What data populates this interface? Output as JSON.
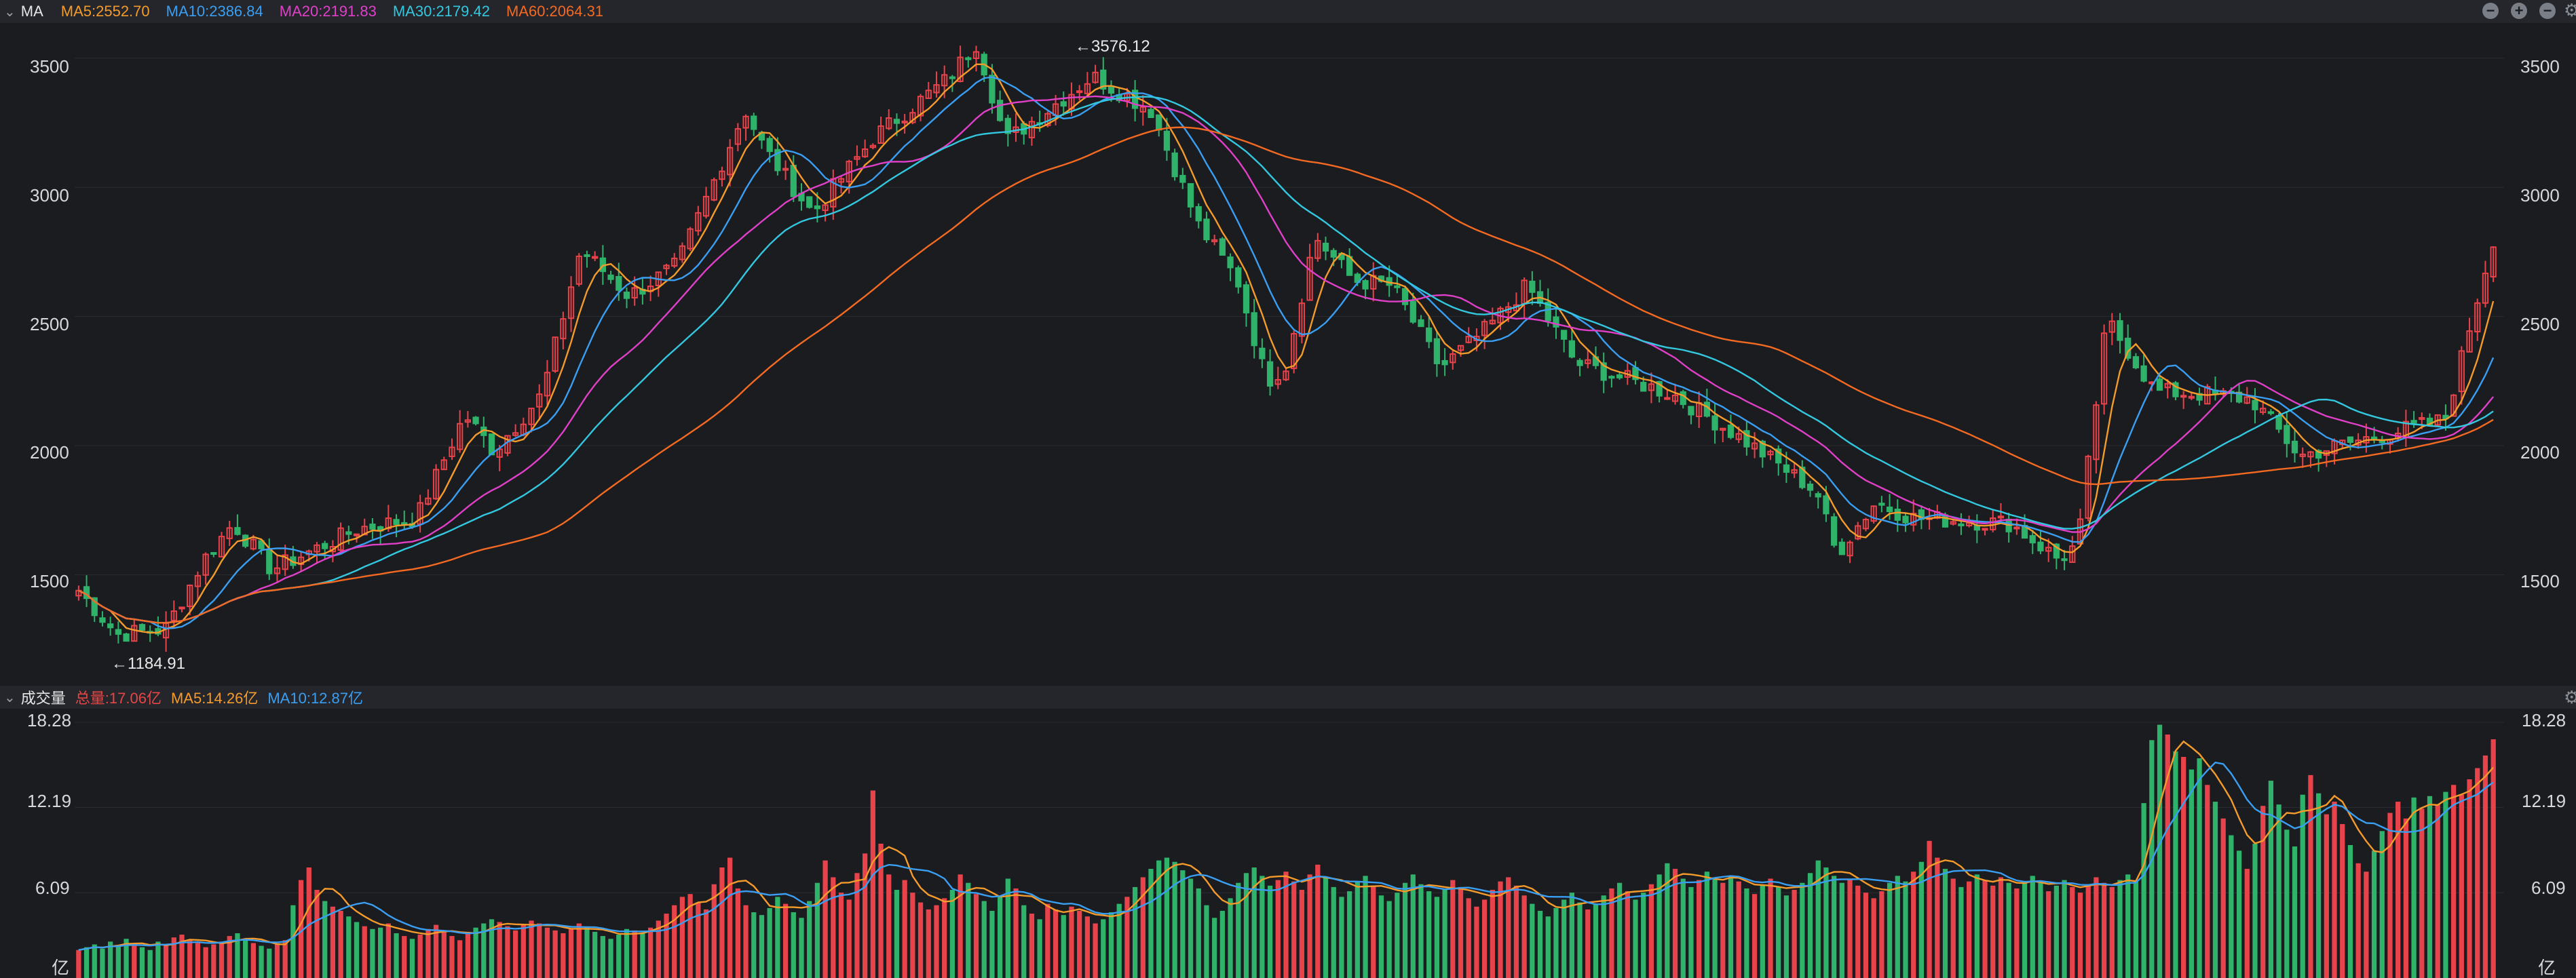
{
  "ma_bar": {
    "title": "MA",
    "items": [
      {
        "label": "MA5:2552.70",
        "color": "#f59b2b"
      },
      {
        "label": "MA10:2386.84",
        "color": "#3a9ff2"
      },
      {
        "label": "MA20:2191.83",
        "color": "#e040c8"
      },
      {
        "label": "MA30:2179.42",
        "color": "#33c8e0"
      },
      {
        "label": "MA60:2064.31",
        "color": "#f46a22"
      }
    ]
  },
  "vol_bar": {
    "title": "成交量",
    "items": [
      {
        "label": "总量:17.06亿",
        "color": "#e84545"
      },
      {
        "label": "MA5:14.26亿",
        "color": "#f59b2b"
      },
      {
        "label": "MA10:12.87亿",
        "color": "#3a9ff2"
      }
    ]
  },
  "price_axis": {
    "ticks": [
      "3500",
      "3000",
      "2500",
      "2000",
      "1500"
    ]
  },
  "volume_axis": {
    "ticks": [
      "18.28",
      "12.19",
      "6.09"
    ],
    "unit": "亿"
  },
  "annotations": {
    "high": "←3576.12",
    "low": "←1184.91"
  },
  "chart_data": {
    "type": "candlestick",
    "price_ylim": [
      1100,
      3620
    ],
    "volume_ylim": [
      0,
      19
    ],
    "up_color": "#e8434a",
    "down_color": "#2fb26a",
    "high_value": 3576.12,
    "low_value": 1184.91,
    "ma_close": {
      "MA5": 2552.7,
      "MA10": 2386.84,
      "MA20": 2191.83,
      "MA30": 2179.42,
      "MA60": 2064.31
    },
    "close_path": [
      [
        0,
        1440
      ],
      [
        8,
        1270
      ],
      [
        18,
        1290
      ],
      [
        26,
        1560
      ],
      [
        32,
        1700
      ],
      [
        40,
        1520
      ],
      [
        58,
        1680
      ],
      [
        70,
        1720
      ],
      [
        80,
        2120
      ],
      [
        86,
        1980
      ],
      [
        96,
        2200
      ],
      [
        104,
        2760
      ],
      [
        114,
        2580
      ],
      [
        124,
        2700
      ],
      [
        138,
        3300
      ],
      [
        142,
        3150
      ],
      [
        152,
        2900
      ],
      [
        165,
        3200
      ],
      [
        180,
        3420
      ],
      [
        186,
        3560
      ],
      [
        192,
        3180
      ],
      [
        210,
        3430
      ],
      [
        222,
        3300
      ],
      [
        232,
        2850
      ],
      [
        240,
        2640
      ],
      [
        246,
        2250
      ],
      [
        250,
        2310
      ],
      [
        256,
        2810
      ],
      [
        264,
        2640
      ],
      [
        272,
        2620
      ],
      [
        282,
        2300
      ],
      [
        292,
        2460
      ],
      [
        300,
        2620
      ],
      [
        310,
        2320
      ],
      [
        330,
        2200
      ],
      [
        345,
        2020
      ],
      [
        360,
        1820
      ],
      [
        364,
        1580
      ],
      [
        372,
        1780
      ],
      [
        380,
        1720
      ],
      [
        400,
        1700
      ],
      [
        410,
        1560
      ],
      [
        414,
        1620
      ],
      [
        420,
        2490
      ],
      [
        430,
        2210
      ],
      [
        440,
        2200
      ],
      [
        450,
        2180
      ],
      [
        460,
        1960
      ],
      [
        470,
        2010
      ],
      [
        490,
        2100
      ],
      [
        500,
        2800
      ]
    ],
    "volume": [
      2.0,
      2.2,
      2.4,
      2.1,
      2.6,
      2.3,
      2.8,
      2.5,
      2.2,
      2.0,
      2.6,
      2.4,
      2.9,
      3.1,
      2.7,
      2.5,
      2.2,
      2.4,
      2.6,
      3.0,
      3.2,
      2.8,
      2.5,
      2.3,
      2.1,
      2.4,
      2.7,
      5.2,
      7.0,
      7.9,
      6.3,
      5.5,
      5.1,
      4.8,
      4.4,
      4.0,
      3.7,
      3.5,
      3.6,
      3.9,
      3.2,
      3.0,
      2.8,
      3.1,
      3.5,
      3.8,
      3.4,
      3.0,
      2.7,
      3.3,
      3.6,
      3.9,
      4.2,
      4.0,
      3.7,
      3.4,
      3.8,
      4.1,
      3.9,
      3.6,
      3.4,
      3.2,
      3.5,
      3.9,
      3.6,
      3.3,
      3.0,
      2.8,
      3.1,
      3.5,
      3.4,
      3.2,
      3.6,
      4.1,
      4.6,
      5.2,
      5.8,
      6.0,
      5.4,
      4.9,
      6.7,
      7.9,
      8.6,
      6.4,
      5.2,
      4.7,
      4.5,
      5.0,
      5.8,
      5.3,
      4.7,
      4.3,
      5.5,
      6.8,
      8.4,
      7.2,
      6.1,
      5.6,
      7.5,
      8.9,
      13.4,
      9.6,
      7.4,
      6.3,
      7.0,
      6.1,
      5.4,
      4.9,
      5.2,
      5.7,
      6.3,
      7.4,
      6.8,
      6.0,
      5.5,
      4.8,
      5.9,
      7.1,
      6.4,
      5.2,
      4.6,
      4.2,
      5.3,
      4.9,
      4.5,
      5.1,
      4.8,
      4.4,
      3.9,
      4.2,
      4.7,
      5.3,
      5.8,
      6.5,
      7.2,
      7.8,
      8.4,
      8.6,
      8.3,
      7.7,
      7.1,
      6.4,
      5.2,
      4.3,
      4.8,
      5.7,
      6.8,
      7.5,
      7.9,
      7.3,
      6.6,
      7.0,
      7.6,
      6.9,
      6.3,
      7.4,
      8.1,
      7.2,
      6.5,
      5.8,
      6.2,
      6.9,
      7.3,
      6.6,
      5.9,
      5.5,
      6.1,
      6.8,
      7.4,
      6.7,
      6.2,
      5.8,
      6.4,
      7.0,
      6.5,
      5.7,
      5.1,
      5.6,
      6.3,
      6.9,
      7.2,
      6.6,
      5.9,
      5.3,
      4.8,
      4.4,
      5.0,
      5.6,
      6.1,
      5.4,
      4.9,
      5.3,
      5.9,
      6.4,
      6.8,
      6.2,
      5.6,
      6.1,
      6.7,
      7.4,
      8.2,
      7.8,
      7.1,
      6.5,
      7.0,
      7.6,
      7.2,
      6.8,
      7.3,
      6.9,
      6.4,
      6.0,
      6.6,
      7.1,
      6.5,
      5.9,
      6.3,
      6.8,
      7.5,
      8.4,
      7.9,
      7.3,
      6.8,
      7.1,
      6.6,
      6.1,
      5.7,
      6.2,
      6.8,
      7.3,
      6.9,
      7.6,
      8.3,
      9.8,
      8.6,
      7.8,
      7.1,
      6.5,
      6.9,
      7.4,
      7.0,
      6.6,
      7.2,
      6.8,
      6.4,
      6.9,
      7.3,
      6.8,
      6.2,
      6.6,
      7.0,
      6.5,
      6.1,
      6.7,
      7.2,
      6.8,
      6.5,
      7.0,
      7.4,
      6.9,
      12.5,
      17.0,
      18.1,
      17.4,
      16.2,
      15.8,
      14.9,
      15.7,
      13.8,
      12.6,
      11.4,
      10.2,
      9.1,
      7.8,
      9.6,
      12.3,
      14.1,
      12.4,
      10.6,
      9.4,
      13.1,
      14.5,
      13.2,
      11.7,
      12.6,
      11.0,
      9.5,
      8.2,
      7.6,
      9.1,
      10.5,
      11.8,
      12.6,
      11.4,
      12.9,
      12.1,
      13.0,
      12.4,
      13.3,
      13.8,
      13.1,
      14.2,
      15.0,
      15.9,
      17.06
    ]
  }
}
